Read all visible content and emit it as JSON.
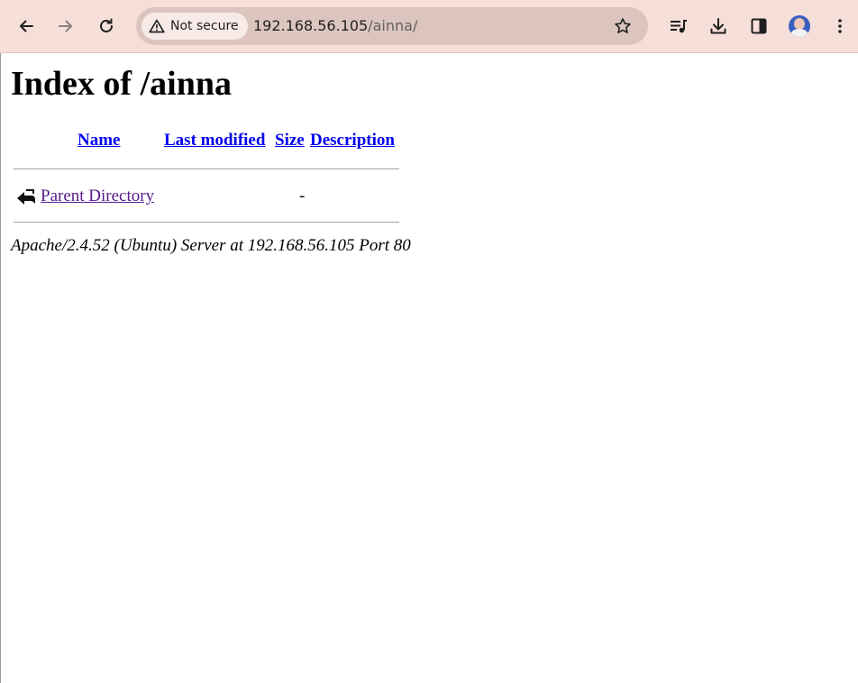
{
  "browser": {
    "security_label": "Not secure",
    "url_host": "192.168.56.105",
    "url_path": "/ainna/"
  },
  "page": {
    "title": "Index of /ainna",
    "columns": {
      "name": "Name",
      "last_modified": "Last modified",
      "size": "Size",
      "description": "Description"
    },
    "rows": [
      {
        "icon": "back-arrow-icon",
        "name": "Parent Directory",
        "last_modified": "",
        "size": "-",
        "description": ""
      }
    ],
    "footer": "Apache/2.4.52 (Ubuntu) Server at 192.168.56.105 Port 80"
  },
  "colors": {
    "link": "#0000ee",
    "visited_link": "#551a8b",
    "toolbar_bg": "#f6dfd9"
  }
}
